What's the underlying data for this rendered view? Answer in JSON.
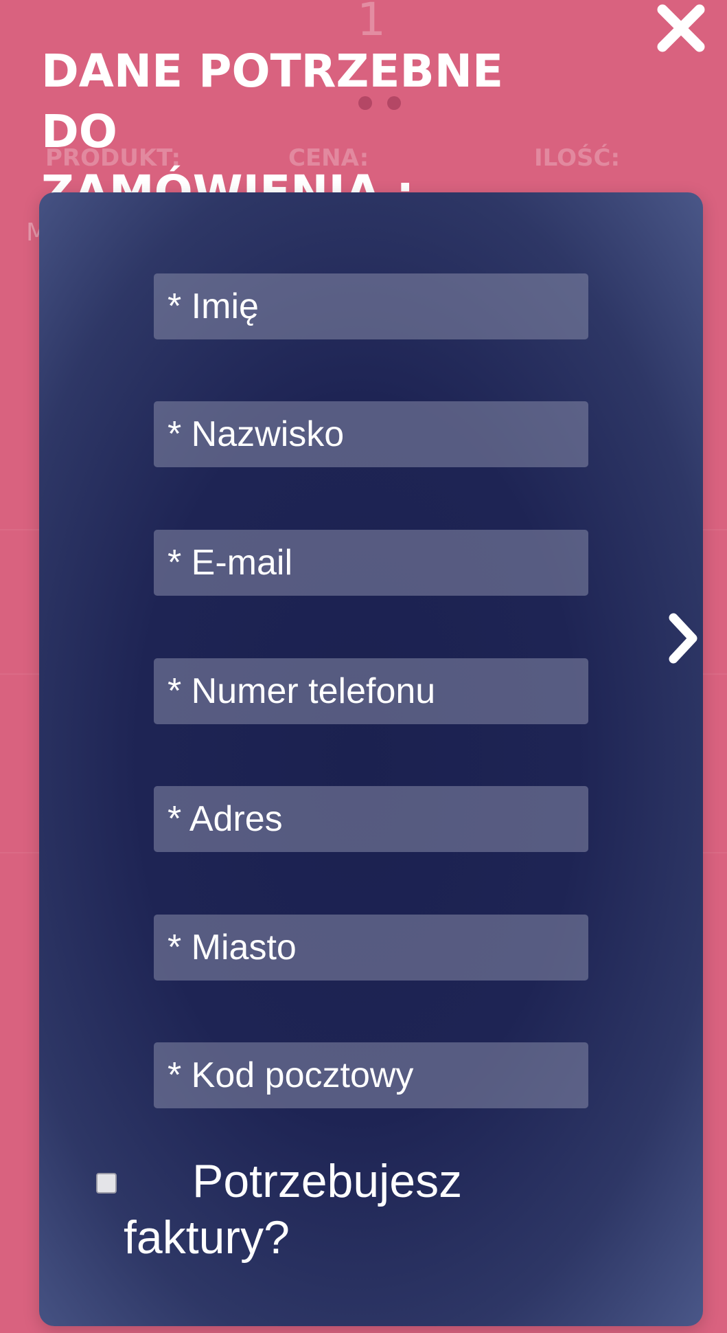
{
  "background": {
    "step_number": "1",
    "column_product": "PRODUKT:",
    "column_price": "CENA:",
    "column_quantity": "ILOŚĆ:",
    "row_letter": "M"
  },
  "modal": {
    "title_line1": "DANE POTRZEBNE DO",
    "title_line2": "ZAMÓWIENIA :",
    "close_icon": "close-icon",
    "next_icon": "chevron-right-icon"
  },
  "form": {
    "fields": [
      {
        "placeholder": "* Imię",
        "value": ""
      },
      {
        "placeholder": "* Nazwisko",
        "value": ""
      },
      {
        "placeholder": "* E-mail",
        "value": ""
      },
      {
        "placeholder": "* Numer telefonu",
        "value": ""
      },
      {
        "placeholder": "* Adres",
        "value": ""
      },
      {
        "placeholder": "* Miasto",
        "value": ""
      },
      {
        "placeholder": "* Kod pocztowy",
        "value": ""
      }
    ],
    "invoice_label": "Potrzebujesz faktury?",
    "invoice_checked": false
  },
  "colors": {
    "page_background": "#d9627f",
    "panel_background": "#1e2454",
    "field_background": "#5d6183",
    "text": "#ffffff"
  }
}
